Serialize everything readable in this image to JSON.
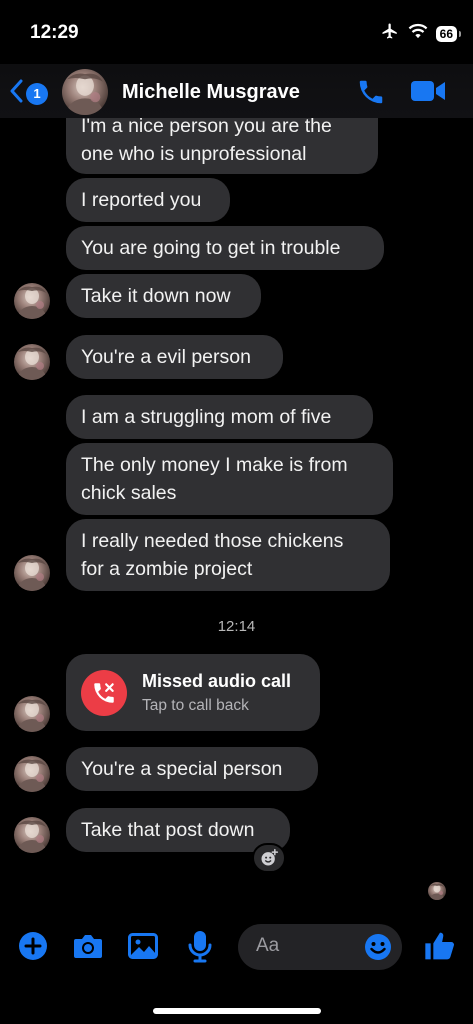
{
  "status_bar": {
    "time": "12:29",
    "battery": "66"
  },
  "header": {
    "unread_count": "1",
    "contact_name": "Michelle Musgrave"
  },
  "messages": [
    "I'm a nice person you are the\none who is unprofessional",
    "I reported you",
    "You are going to get in trouble",
    "Take it down now",
    "You're a evil person",
    "I am a struggling mom of five",
    "The only money I make is from\nchick sales",
    "I really needed those chickens\nfor a zombie project",
    "You're a special person",
    "Take that post down"
  ],
  "timestamp": "12:14",
  "missed_call": {
    "title": "Missed audio call",
    "subtitle": "Tap to call back"
  },
  "composer": {
    "placeholder": "Aa"
  },
  "colors": {
    "accent": "#1877f2",
    "bubble": "#303033",
    "missed_call": "#ec3d46",
    "background": "#000000"
  },
  "icons": [
    "airplane-icon",
    "wifi-icon",
    "back-chevron-icon",
    "phone-icon",
    "video-camera-icon",
    "missed-call-icon",
    "add-reaction-icon",
    "plus-icon",
    "camera-icon",
    "gallery-icon",
    "microphone-icon",
    "emoji-icon",
    "thumbs-up-icon"
  ]
}
